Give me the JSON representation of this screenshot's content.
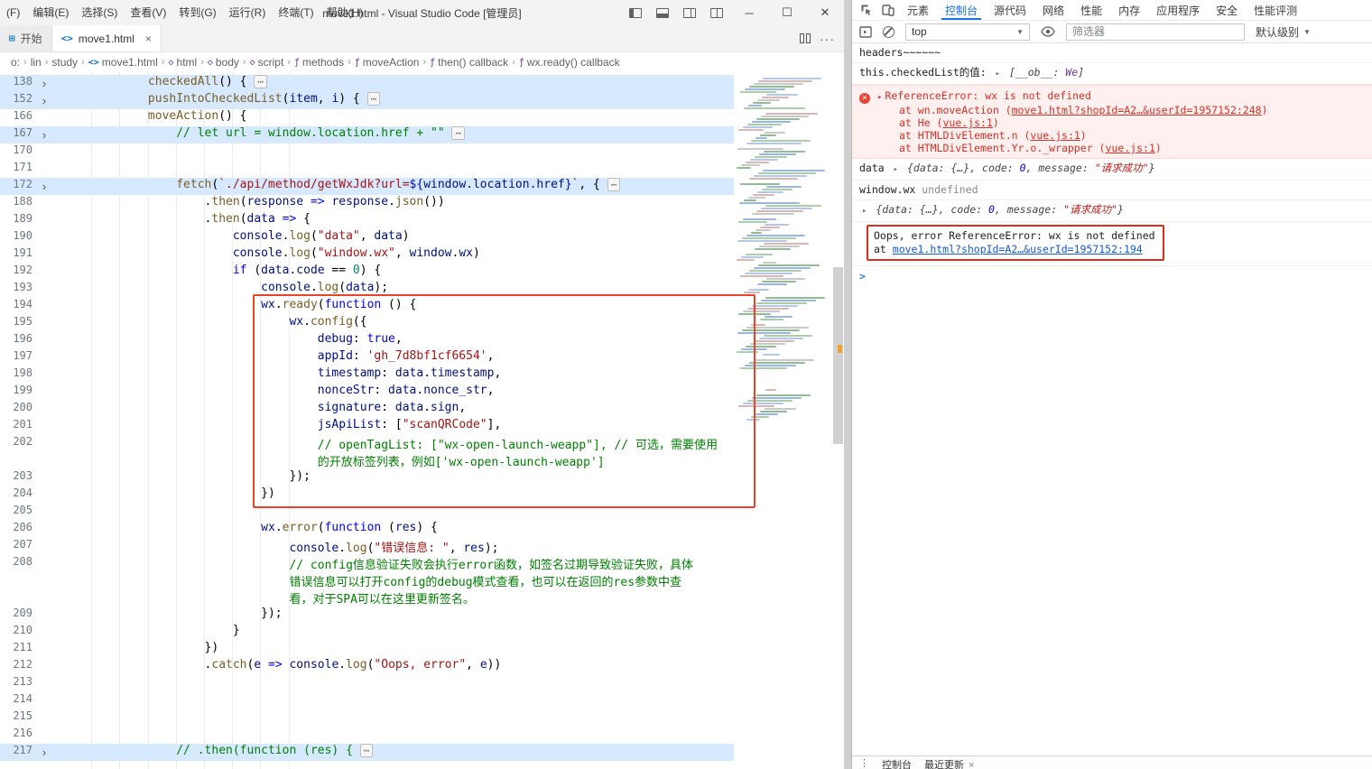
{
  "window": {
    "title": "move1.html - Visual Studio Code [管理员]",
    "menus": [
      "(F)",
      "编辑(E)",
      "选择(S)",
      "查看(V)",
      "转到(G)",
      "运行(R)",
      "终端(T)",
      "帮助(H)"
    ]
  },
  "tabs": {
    "start_label": "开始",
    "active_label": "move1.html",
    "close_glyph": "×",
    "more_glyph": "···"
  },
  "breadcrumb": [
    {
      "label": "o:"
    },
    {
      "label": "lin"
    },
    {
      "label": "study"
    },
    {
      "label": "move1.html",
      "icon": "file"
    },
    {
      "label": "html",
      "icon": "tag"
    },
    {
      "label": "body",
      "icon": "tag"
    },
    {
      "label": "script",
      "icon": "tag"
    },
    {
      "label": "methods",
      "icon": "fn"
    },
    {
      "label": "moveAction",
      "icon": "fn"
    },
    {
      "label": "then() callback",
      "icon": "fn"
    },
    {
      "label": "wx.ready() callback",
      "icon": "fn"
    }
  ],
  "editor": {
    "rows": [
      {
        "ln": "138",
        "fold": true,
        "hl": true,
        "ind": 12,
        "segs": [
          [
            "f",
            "checkedAll"
          ],
          [
            "p",
            "() { "
          ],
          [
            "e",
            "⋯"
          ]
        ]
      },
      {
        "ln": "152",
        "fold": true,
        "hl": true,
        "ind": 12,
        "segs": [
          [
            "f",
            "pushIntoCheckedList"
          ],
          [
            "p",
            "("
          ],
          [
            "v",
            "item"
          ],
          [
            "p",
            ", "
          ],
          [
            "v",
            "i"
          ],
          [
            "p",
            ") { "
          ],
          [
            "e",
            "⋯"
          ]
        ]
      },
      {
        "ln": "166",
        "ind": 12,
        "segs": [
          [
            "f",
            "moveAction"
          ],
          [
            "p",
            "() {"
          ]
        ]
      },
      {
        "ln": "167",
        "fold": true,
        "hl": true,
        "ind": 16,
        "segs": [
          [
            "c",
            "// let url = window.location.href + \"\" "
          ],
          [
            "e",
            "⋯"
          ]
        ]
      },
      {
        "ln": "170",
        "ind": 0,
        "segs": []
      },
      {
        "ln": "171",
        "ind": 0,
        "segs": []
      },
      {
        "ln": "172",
        "fold": true,
        "hl": true,
        "ind": 16,
        "segs": [
          [
            "f",
            "fetch"
          ],
          [
            "p",
            "("
          ],
          [
            "s",
            "`./api/method/getWxJdk?url="
          ],
          [
            "k",
            "${"
          ],
          [
            "v",
            "window.location.href"
          ],
          [
            "k",
            "}"
          ],
          [
            "s",
            "`"
          ],
          [
            "p",
            ", { "
          ],
          [
            "e",
            "⋯"
          ]
        ]
      },
      {
        "ln": "188",
        "ind": 20,
        "segs": [
          [
            "p",
            "."
          ],
          [
            "f",
            "then"
          ],
          [
            "p",
            "("
          ],
          [
            "v",
            "response"
          ],
          [
            "k",
            " => "
          ],
          [
            "v",
            "response"
          ],
          [
            "p",
            "."
          ],
          [
            "f",
            "json"
          ],
          [
            "p",
            "())"
          ]
        ]
      },
      {
        "ln": "189",
        "ind": 20,
        "segs": [
          [
            "p",
            "."
          ],
          [
            "f",
            "then"
          ],
          [
            "p",
            "("
          ],
          [
            "v",
            "data"
          ],
          [
            "k",
            " => "
          ],
          [
            "p",
            "{"
          ]
        ]
      },
      {
        "ln": "190",
        "ind": 24,
        "segs": [
          [
            "v",
            "console"
          ],
          [
            "p",
            "."
          ],
          [
            "f",
            "log"
          ],
          [
            "p",
            "("
          ],
          [
            "s",
            "\"data\""
          ],
          [
            "p",
            ", "
          ],
          [
            "v",
            "data"
          ],
          [
            "p",
            ")"
          ]
        ]
      },
      {
        "ln": "191",
        "ind": 24,
        "segs": [
          [
            "v",
            "console"
          ],
          [
            "p",
            "."
          ],
          [
            "f",
            "log"
          ],
          [
            "p",
            "("
          ],
          [
            "s",
            "\"window.wx\""
          ],
          [
            "p",
            ", "
          ],
          [
            "v",
            "window"
          ],
          [
            "p",
            "."
          ],
          [
            "v",
            "wx"
          ],
          [
            "p",
            ")"
          ]
        ]
      },
      {
        "ln": "192",
        "ind": 24,
        "segs": [
          [
            "k",
            "if"
          ],
          [
            "p",
            " ("
          ],
          [
            "v",
            "data"
          ],
          [
            "p",
            "."
          ],
          [
            "v",
            "code"
          ],
          [
            "p",
            " == "
          ],
          [
            "n",
            "0"
          ],
          [
            "p",
            ") {"
          ]
        ]
      },
      {
        "ln": "193",
        "ind": 28,
        "segs": [
          [
            "v",
            "console"
          ],
          [
            "p",
            "."
          ],
          [
            "f",
            "log"
          ],
          [
            "p",
            "("
          ],
          [
            "v",
            "data"
          ],
          [
            "p",
            ");"
          ]
        ]
      },
      {
        "ln": "194",
        "ind": 28,
        "segs": [
          [
            "v",
            "wx"
          ],
          [
            "p",
            "."
          ],
          [
            "f",
            "ready"
          ],
          [
            "p",
            "("
          ],
          [
            "k",
            "function"
          ],
          [
            "p",
            " () {"
          ]
        ]
      },
      {
        "ln": "195",
        "ind": 32,
        "segs": [
          [
            "v",
            "wx"
          ],
          [
            "p",
            "."
          ],
          [
            "f",
            "config"
          ],
          [
            "p",
            "({"
          ]
        ]
      },
      {
        "ln": "196",
        "ind": 36,
        "segs": [
          [
            "v",
            "debug"
          ],
          [
            "p",
            ": "
          ],
          [
            "k",
            "true"
          ],
          [
            "p",
            ","
          ]
        ]
      },
      {
        "ln": "197",
        "ind": 36,
        "segs": [
          [
            "v",
            "appId"
          ],
          [
            "p",
            ": "
          ],
          [
            "s",
            "'gh_7d8bf1cf6654'"
          ],
          [
            "p",
            ","
          ]
        ]
      },
      {
        "ln": "198",
        "ind": 36,
        "segs": [
          [
            "v",
            "timestamp"
          ],
          [
            "p",
            ": "
          ],
          [
            "v",
            "data"
          ],
          [
            "p",
            "."
          ],
          [
            "v",
            "timestamp"
          ],
          [
            "p",
            ","
          ]
        ]
      },
      {
        "ln": "199",
        "ind": 36,
        "segs": [
          [
            "v",
            "nonceStr"
          ],
          [
            "p",
            ": "
          ],
          [
            "v",
            "data"
          ],
          [
            "p",
            "."
          ],
          [
            "v",
            "nonce_str"
          ],
          [
            "p",
            ","
          ]
        ]
      },
      {
        "ln": "200",
        "ind": 36,
        "segs": [
          [
            "v",
            "signature"
          ],
          [
            "p",
            ": "
          ],
          [
            "v",
            "data"
          ],
          [
            "p",
            "."
          ],
          [
            "v",
            "sign"
          ],
          [
            "p",
            ","
          ]
        ]
      },
      {
        "ln": "201",
        "ind": 36,
        "segs": [
          [
            "v",
            "jsApiList"
          ],
          [
            "p",
            ": ["
          ],
          [
            "s",
            "\"scanQRCode\""
          ],
          [
            "p",
            "],"
          ]
        ]
      },
      {
        "ln": "202",
        "ind": 36,
        "segs": [
          [
            "c",
            "// openTagList: [\"wx-open-launch-weapp\"], // 可选，需要使用"
          ]
        ]
      },
      {
        "ln": "",
        "ind": 36,
        "segs": [
          [
            "c",
            "的开放标签列表，例如['wx-open-launch-weapp']"
          ]
        ]
      },
      {
        "ln": "203",
        "ind": 32,
        "segs": [
          [
            "p",
            "});"
          ]
        ]
      },
      {
        "ln": "204",
        "ind": 28,
        "segs": [
          [
            "p",
            "})"
          ]
        ]
      },
      {
        "ln": "205",
        "ind": 0,
        "segs": []
      },
      {
        "ln": "206",
        "ind": 28,
        "segs": [
          [
            "v",
            "wx"
          ],
          [
            "p",
            "."
          ],
          [
            "f",
            "error"
          ],
          [
            "p",
            "("
          ],
          [
            "k",
            "function"
          ],
          [
            "p",
            " ("
          ],
          [
            "v",
            "res"
          ],
          [
            "p",
            ") {"
          ]
        ]
      },
      {
        "ln": "207",
        "ind": 32,
        "segs": [
          [
            "v",
            "console"
          ],
          [
            "p",
            "."
          ],
          [
            "f",
            "log"
          ],
          [
            "p",
            "("
          ],
          [
            "s",
            "\"错误信息: \""
          ],
          [
            "p",
            ", "
          ],
          [
            "v",
            "res"
          ],
          [
            "p",
            ");"
          ]
        ]
      },
      {
        "ln": "208",
        "ind": 32,
        "segs": [
          [
            "c",
            "// config信息验证失败会执行error函数，如签名过期导致验证失败，具体"
          ]
        ]
      },
      {
        "ln": "",
        "ind": 32,
        "segs": [
          [
            "c",
            "错误信息可以打开config的debug模式查看，也可以在返回的res参数中查"
          ]
        ]
      },
      {
        "ln": "",
        "ind": 32,
        "segs": [
          [
            "c",
            "看，对于SPA可以在这里更新签名。"
          ]
        ]
      },
      {
        "ln": "209",
        "ind": 28,
        "segs": [
          [
            "p",
            "});"
          ]
        ]
      },
      {
        "ln": "210",
        "ind": 24,
        "segs": [
          [
            "p",
            "}"
          ]
        ]
      },
      {
        "ln": "211",
        "ind": 20,
        "segs": [
          [
            "p",
            "})"
          ]
        ]
      },
      {
        "ln": "212",
        "ind": 20,
        "segs": [
          [
            "p",
            "."
          ],
          [
            "f",
            "catch"
          ],
          [
            "p",
            "("
          ],
          [
            "v",
            "e"
          ],
          [
            "k",
            " => "
          ],
          [
            "v",
            "console"
          ],
          [
            "p",
            "."
          ],
          [
            "f",
            "log"
          ],
          [
            "p",
            "("
          ],
          [
            "s",
            "\"Oops, error\""
          ],
          [
            "p",
            ", "
          ],
          [
            "v",
            "e"
          ],
          [
            "p",
            "))"
          ]
        ]
      },
      {
        "ln": "213",
        "ind": 0,
        "segs": []
      },
      {
        "ln": "214",
        "ind": 0,
        "segs": []
      },
      {
        "ln": "215",
        "ind": 0,
        "segs": []
      },
      {
        "ln": "216",
        "ind": 0,
        "segs": []
      },
      {
        "ln": "217",
        "fold": true,
        "hl": true,
        "ind": 16,
        "segs": [
          [
            "c",
            "// .then(function (res) { "
          ],
          [
            "e",
            "⋯"
          ]
        ]
      }
    ]
  },
  "devtools": {
    "tabs": [
      {
        "label": "元素"
      },
      {
        "label": "控制台",
        "active": true
      },
      {
        "label": "源代码"
      },
      {
        "label": "网络"
      },
      {
        "label": "性能"
      },
      {
        "label": "内存"
      },
      {
        "label": "应用程序"
      },
      {
        "label": "安全"
      },
      {
        "label": "性能评测"
      }
    ],
    "toolbar": {
      "context": "top",
      "filter_placeholder": "筛选器",
      "level": "默认级别"
    },
    "console": {
      "prompt": ">",
      "rows": [
        {
          "kind": "log",
          "parts": [
            [
              "t",
              "headers~~~~~~"
            ]
          ]
        },
        {
          "kind": "log",
          "parts": [
            [
              "t",
              "this.checkedList的值:  "
            ],
            [
              "tri",
              "▸"
            ],
            [
              "prev",
              " ["
            ],
            [
              "prev",
              "__ob__: "
            ],
            [
              "cls",
              "We"
            ],
            [
              "prev",
              "]"
            ]
          ]
        },
        {
          "kind": "error",
          "lines": [
            {
              "first": true,
              "parts": [
                [
                  "etri",
                  "▸"
                ],
                [
                  "err",
                  "ReferenceError: wx is not defined"
                ]
              ]
            },
            {
              "parts": [
                [
                  "err",
                  "at wn.moveAction ("
                ],
                [
                  "elink",
                  "move1.html?shopId=A2…&userId=1957152:248"
                ],
                [
                  "err",
                  ")"
                ]
              ]
            },
            {
              "parts": [
                [
                  "err",
                  "at He ("
                ],
                [
                  "elink",
                  "vue.js:1"
                ],
                [
                  "err",
                  ")"
                ]
              ]
            },
            {
              "parts": [
                [
                  "err",
                  "at HTMLDivElement.n ("
                ],
                [
                  "elink",
                  "vue.js:1"
                ],
                [
                  "err",
                  ")"
                ]
              ]
            },
            {
              "parts": [
                [
                  "err",
                  "at HTMLDivElement.Yr.o._wrapper ("
                ],
                [
                  "elink",
                  "vue.js:1"
                ],
                [
                  "err",
                  ")"
                ]
              ]
            }
          ]
        },
        {
          "kind": "log",
          "parts": [
            [
              "t",
              "data "
            ],
            [
              "tri",
              "▸"
            ],
            [
              "prev",
              " {data: {…}, code: "
            ],
            [
              "num",
              "0"
            ],
            [
              "prev",
              ", message: "
            ],
            [
              "str",
              "\"请求成功\""
            ],
            [
              "prev",
              "}"
            ]
          ]
        },
        {
          "kind": "log",
          "parts": [
            [
              "t",
              "window.wx "
            ],
            [
              "und",
              "undefined"
            ]
          ]
        },
        {
          "kind": "log",
          "parts": [
            [
              "tri",
              "▸"
            ],
            [
              "prev",
              " {data: {…}, code: "
            ],
            [
              "num",
              "0"
            ],
            [
              "prev",
              ", message: "
            ],
            [
              "str",
              "\"请求成功\""
            ],
            [
              "prev",
              "}"
            ]
          ]
        },
        {
          "kind": "boxed",
          "lines": [
            {
              "parts": [
                [
                  "t",
                  "Oops, error ReferenceError: wx is not defined"
                ]
              ]
            },
            {
              "parts": [
                [
                  "t",
                  "    at "
                ],
                [
                  "link",
                  "move1.html?shopId=A2…&userId=1957152:194"
                ]
              ]
            }
          ]
        },
        {
          "kind": "prompt"
        }
      ]
    },
    "bottom": {
      "menu_glyph": "⋮",
      "tabs": [
        {
          "label": "控制台"
        },
        {
          "label": "最近更新",
          "closable": true
        }
      ]
    }
  }
}
